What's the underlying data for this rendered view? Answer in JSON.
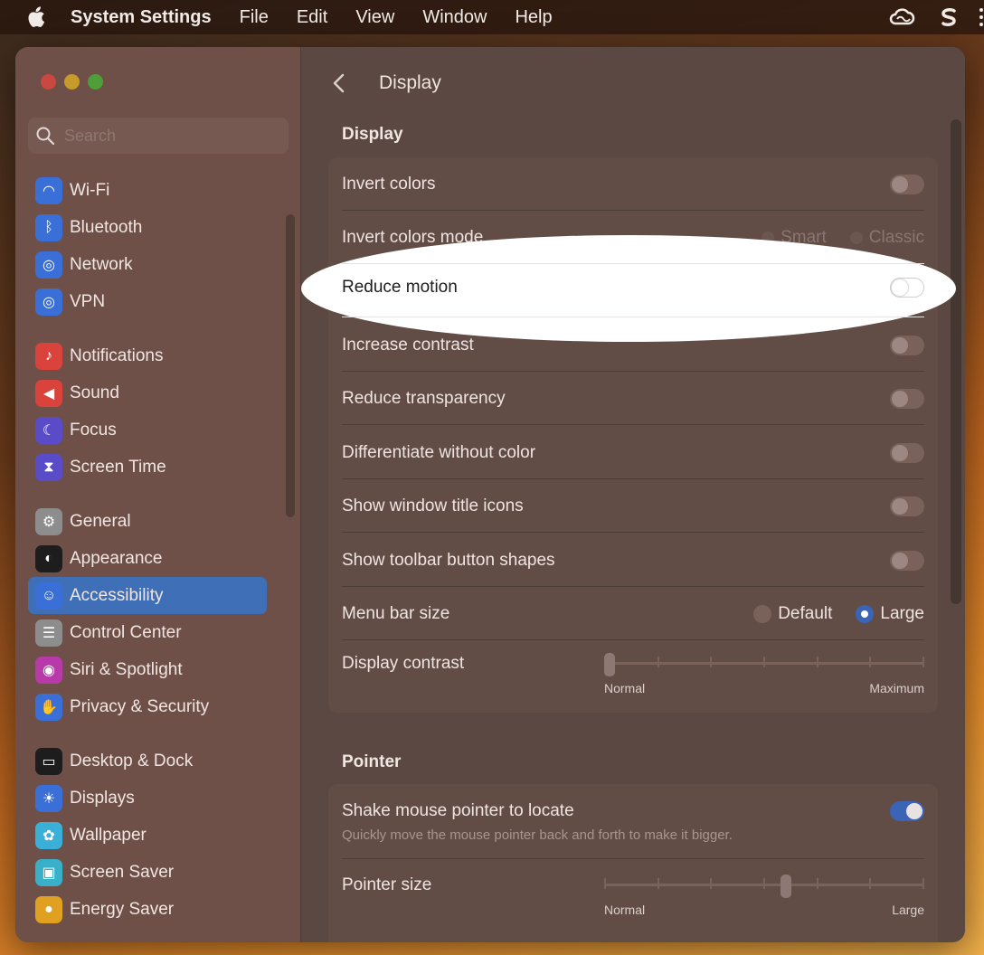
{
  "menubar": {
    "app_name": "System Settings",
    "items": [
      "File",
      "Edit",
      "View",
      "Window",
      "Help"
    ],
    "right_icons": [
      "creative-cloud-icon",
      "s-logo-icon",
      "more-icon"
    ]
  },
  "search": {
    "placeholder": "Search"
  },
  "sidebar": {
    "items": [
      {
        "label": "Wi-Fi",
        "icon": "wifi-icon",
        "color": "#3a6fd8"
      },
      {
        "label": "Bluetooth",
        "icon": "bluetooth-icon",
        "color": "#3a6fd8"
      },
      {
        "label": "Network",
        "icon": "globe-icon",
        "color": "#3a6fd8"
      },
      {
        "label": "VPN",
        "icon": "vpn-icon",
        "color": "#3a6fd8"
      },
      {
        "label": "Notifications",
        "icon": "bell-icon",
        "color": "#d9433b"
      },
      {
        "label": "Sound",
        "icon": "speaker-icon",
        "color": "#d9433b"
      },
      {
        "label": "Focus",
        "icon": "moon-icon",
        "color": "#5a4bc9"
      },
      {
        "label": "Screen Time",
        "icon": "hourglass-icon",
        "color": "#5a4bc9"
      },
      {
        "label": "General",
        "icon": "gear-icon",
        "color": "#8d8d8d"
      },
      {
        "label": "Appearance",
        "icon": "appearance-icon",
        "color": "#1d1d1d"
      },
      {
        "label": "Accessibility",
        "icon": "accessibility-icon",
        "color": "#3a6fd8"
      },
      {
        "label": "Control Center",
        "icon": "control-center-icon",
        "color": "#8d8d8d"
      },
      {
        "label": "Siri & Spotlight",
        "icon": "siri-icon",
        "color": "#b83aa8"
      },
      {
        "label": "Privacy & Security",
        "icon": "hand-icon",
        "color": "#3a6fd8"
      },
      {
        "label": "Desktop & Dock",
        "icon": "dock-icon",
        "color": "#1d1d1d"
      },
      {
        "label": "Displays",
        "icon": "sun-icon",
        "color": "#3a6fd8"
      },
      {
        "label": "Wallpaper",
        "icon": "flower-icon",
        "color": "#3ab0d8"
      },
      {
        "label": "Screen Saver",
        "icon": "screensaver-icon",
        "color": "#3ab0c8"
      },
      {
        "label": "Energy Saver",
        "icon": "bulb-icon",
        "color": "#e0a020"
      }
    ]
  },
  "main": {
    "title": "Display",
    "display_section": {
      "heading": "Display",
      "invert_colors": "Invert colors",
      "invert_colors_mode": "Invert colors mode",
      "invert_mode_options": [
        "Smart",
        "Classic"
      ],
      "reduce_motion": "Reduce motion",
      "increase_contrast": "Increase contrast",
      "reduce_transparency": "Reduce transparency",
      "differentiate_without_color": "Differentiate without color",
      "show_window_title_icons": "Show window title icons",
      "show_toolbar_button_shapes": "Show toolbar button shapes",
      "menu_bar_size": "Menu bar size",
      "menu_bar_options": [
        "Default",
        "Large"
      ],
      "menu_bar_selected": "Large",
      "display_contrast": "Display contrast",
      "display_contrast_min": "Normal",
      "display_contrast_max": "Maximum",
      "display_contrast_value": 0
    },
    "pointer_section": {
      "heading": "Pointer",
      "shake_label": "Shake mouse pointer to locate",
      "shake_desc": "Quickly move the mouse pointer back and forth to make it bigger.",
      "shake_on": true,
      "pointer_size": "Pointer size",
      "pointer_size_min": "Normal",
      "pointer_size_max": "Large",
      "pointer_size_value": 0.57
    }
  }
}
